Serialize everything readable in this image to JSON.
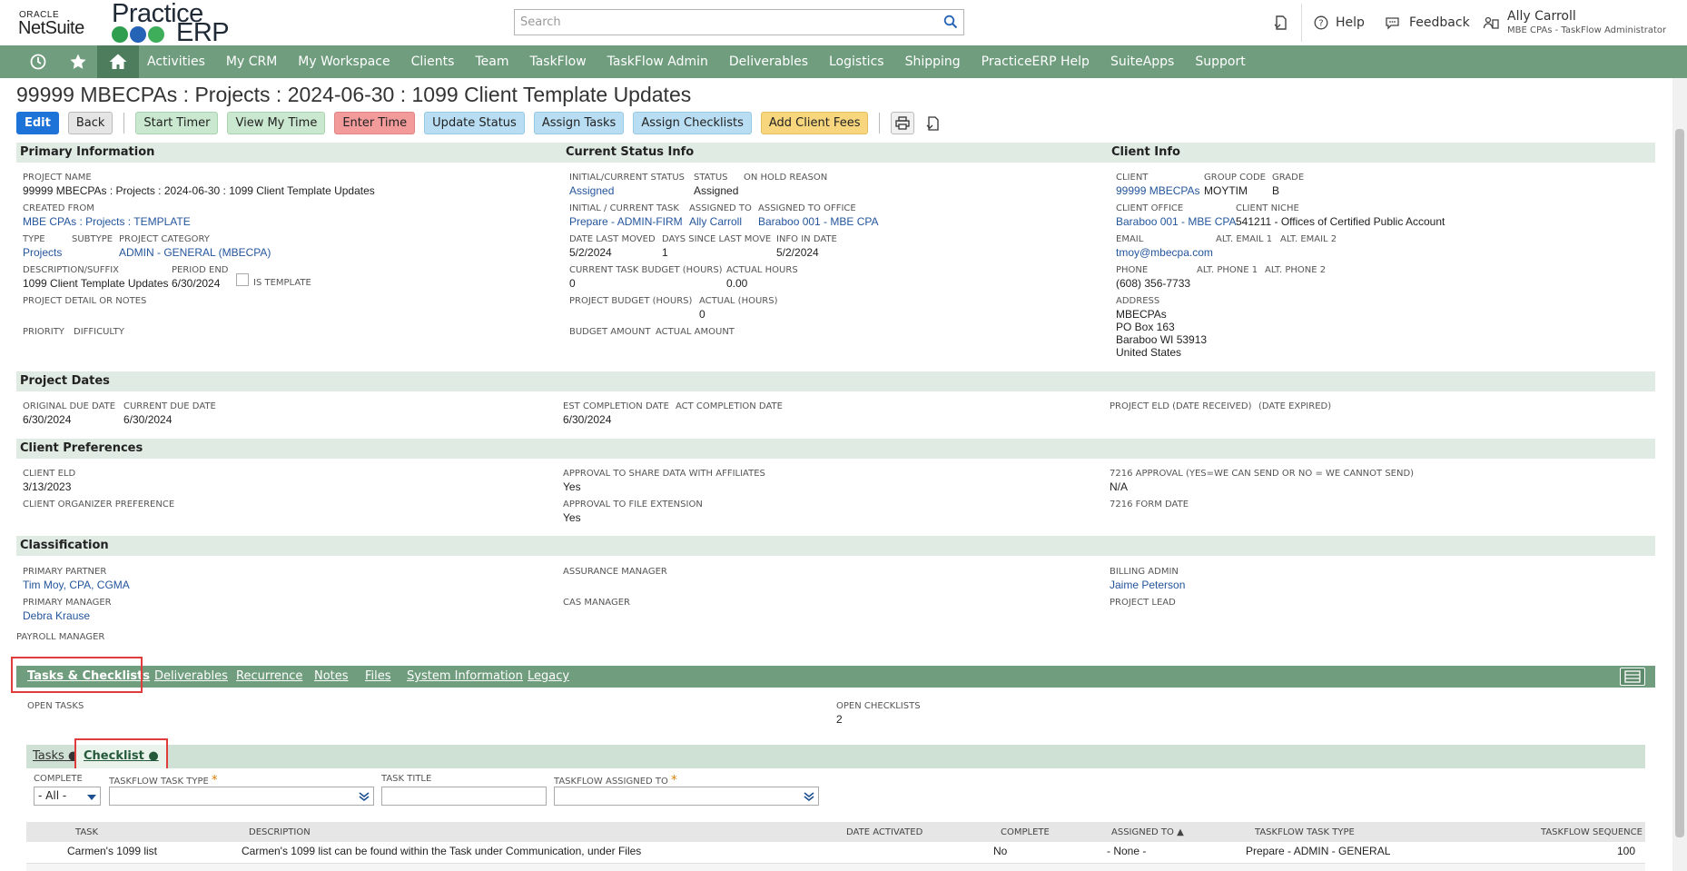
{
  "header": {
    "oracle": "ORACLE",
    "netsuite": "NetSuite",
    "logo_word1": "Practice",
    "logo_word2": "ERP",
    "search_placeholder": "Search",
    "help": "Help",
    "feedback": "Feedback",
    "user_name": "Ally Carroll",
    "user_role": "MBE CPAs - TaskFlow Administrator"
  },
  "nav": {
    "items": [
      "Activities",
      "My CRM",
      "My Workspace",
      "Clients",
      "Team",
      "TaskFlow",
      "TaskFlow Admin",
      "Deliverables",
      "Logistics",
      "Shipping",
      "PracticeERP Help",
      "SuiteApps",
      "Support"
    ]
  },
  "page": {
    "title": "99999 MBECPAs : Projects : 2024-06-30 : 1099 Client Template Updates"
  },
  "buttons": {
    "edit": "Edit",
    "back": "Back",
    "start_timer": "Start Timer",
    "view_my_time": "View My Time",
    "enter_time": "Enter Time",
    "update_status": "Update Status",
    "assign_tasks": "Assign Tasks",
    "assign_checklists": "Assign Checklists",
    "add_client_fees": "Add Client Fees"
  },
  "primary": {
    "header": "Primary Information",
    "project_name_label": "PROJECT NAME",
    "project_name": "99999 MBECPAs : Projects : 2024-06-30 : 1099 Client Template Updates",
    "created_from_label": "CREATED FROM",
    "created_from": "MBE CPAs : Projects : TEMPLATE",
    "type_label": "TYPE",
    "type": "Projects",
    "subtype_label": "SUBTYPE",
    "project_category_label": "PROJECT CATEGORY",
    "project_category": "ADMIN - GENERAL (MBECPA)",
    "desc_label": "DESCRIPTION/SUFFIX",
    "desc": "1099 Client Template Updates",
    "period_end_label": "PERIOD END",
    "period_end": "6/30/2024",
    "is_template_label": "IS TEMPLATE",
    "detail_label": "PROJECT DETAIL OR NOTES",
    "priority_label": "PRIORITY",
    "difficulty_label": "DIFFICULTY"
  },
  "status": {
    "header": "Current Status Info",
    "initial_status_label": "INITIAL/CURRENT STATUS",
    "initial_status": "Assigned",
    "status_label": "STATUS",
    "status": "Assigned",
    "on_hold_label": "ON HOLD REASON",
    "initial_task_label": "INITIAL / CURRENT TASK",
    "initial_task": "Prepare - ADMIN-FIRM",
    "assigned_to_label": "ASSIGNED TO",
    "assigned_to": "Ally Carroll",
    "assigned_office_label": "ASSIGNED TO OFFICE",
    "assigned_office": "Baraboo 001 - MBE CPA",
    "date_last_moved_label": "DATE LAST MOVED",
    "date_last_moved": "5/2/2024",
    "days_since_label": "DAYS SINCE LAST MOVE",
    "days_since": "1",
    "info_in_date_label": "INFO IN DATE",
    "info_in_date": "5/2/2024",
    "task_budget_label": "CURRENT TASK BUDGET (HOURS)",
    "task_budget": "0",
    "actual_hours_label": "ACTUAL HOURS",
    "actual_hours": "0.00",
    "project_budget_label": "PROJECT BUDGET (HOURS)",
    "actual_label": "ACTUAL (HOURS)",
    "actual": "0",
    "budget_amount_label": "BUDGET AMOUNT",
    "actual_amount_label": "ACTUAL AMOUNT"
  },
  "client": {
    "header": "Client Info",
    "client_label": "CLIENT",
    "client": "99999 MBECPAs",
    "group_code_label": "GROUP CODE",
    "group_code": "MOYTIM",
    "grade_label": "GRADE",
    "grade": "B",
    "office_label": "CLIENT OFFICE",
    "office": "Baraboo 001 - MBE CPA",
    "niche_label": "CLIENT NICHE",
    "niche": "541211 - Offices of Certified Public Account",
    "email_label": "EMAIL",
    "email": "tmoy@mbecpa.com",
    "alt_email1_label": "ALT. EMAIL 1",
    "alt_email2_label": "ALT. EMAIL 2",
    "phone_label": "PHONE",
    "phone": "(608) 356-7733",
    "alt_phone1_label": "ALT. PHONE 1",
    "alt_phone2_label": "ALT. PHONE 2",
    "address_label": "ADDRESS",
    "address1": "MBECPAs",
    "address2": "PO Box 163",
    "address3": "Baraboo WI 53913",
    "address4": "United States"
  },
  "dates": {
    "header": "Project Dates",
    "orig_due_label": "ORIGINAL DUE DATE",
    "orig_due": "6/30/2024",
    "cur_due_label": "CURRENT DUE DATE",
    "cur_due": "6/30/2024",
    "est_label": "EST COMPLETION DATE",
    "est": "6/30/2024",
    "act_label": "ACT COMPLETION DATE",
    "eld_label": "PROJECT ELD (DATE RECEIVED)",
    "expired_label": "(DATE EXPIRED)"
  },
  "prefs": {
    "header": "Client Preferences",
    "eld_label": "CLIENT ELD",
    "eld": "3/13/2023",
    "share_label": "APPROVAL TO SHARE DATA WITH AFFILIATES",
    "share": "Yes",
    "approval7216_label": "7216 APPROVAL (YES=WE CAN SEND OR NO = WE CANNOT SEND)",
    "approval7216": "N/A",
    "organizer_label": "CLIENT ORGANIZER PREFERENCE",
    "extension_label": "APPROVAL TO FILE EXTENSION",
    "extension": "Yes",
    "form7216_label": "7216 FORM DATE"
  },
  "classification": {
    "header": "Classification",
    "partner_label": "PRIMARY PARTNER",
    "partner": "Tim Moy, CPA, CGMA",
    "assurance_label": "ASSURANCE MANAGER",
    "billing_label": "BILLING ADMIN",
    "billing": "Jaime Peterson",
    "manager_label": "PRIMARY MANAGER",
    "manager": "Debra Krause",
    "cas_label": "CAS MANAGER",
    "lead_label": "PROJECT LEAD",
    "payroll_label": "PAYROLL MANAGER"
  },
  "tabs": {
    "items": [
      "Tasks & Checklists",
      "Deliverables",
      "Recurrence",
      "Notes",
      "Files",
      "System Information",
      "Legacy"
    ],
    "open_tasks_label": "OPEN TASKS",
    "open_checklists_label": "OPEN CHECKLISTS",
    "open_checklists": "2"
  },
  "subtabs": {
    "tasks": "Tasks",
    "checklist": "Checklist"
  },
  "filters": {
    "complete_label": "COMPLETE",
    "complete_value": "- All -",
    "type_label": "TASKFLOW TASK TYPE",
    "title_label": "TASK TITLE",
    "assigned_label": "TASKFLOW ASSIGNED TO",
    "required_mark": "*"
  },
  "grid": {
    "headers": [
      "TASK",
      "DESCRIPTION",
      "DATE ACTIVATED",
      "COMPLETE",
      "ASSIGNED TO ▲",
      "TASKFLOW TASK TYPE",
      "TASKFLOW SEQUENCE"
    ],
    "row1": [
      "Carmen's 1099 list",
      "Carmen's 1099 list can be found within the Task under Communication, under Files",
      "",
      "No",
      "- None -",
      "Prepare - ADMIN - GENERAL",
      "100"
    ]
  },
  "colors": {
    "nav_green": "#6f9d7e",
    "section_bg": "#e0ebe3",
    "link_blue": "#24559c",
    "highlight_red": "#e03c3c"
  }
}
